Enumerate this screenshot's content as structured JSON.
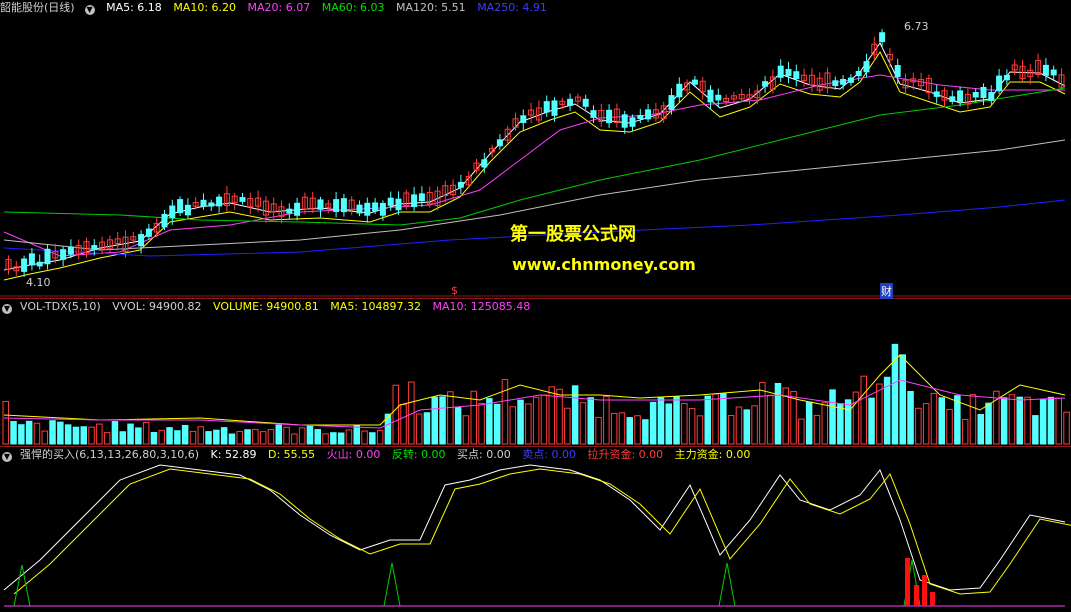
{
  "main_legend": {
    "title": "韶能股份(日线)",
    "ma5": "MA5: 6.18",
    "ma10": "MA10: 6.20",
    "ma20": "MA20: 6.07",
    "ma60": "MA60: 6.03",
    "ma120": "MA120: 5.51",
    "ma250": "MA250: 4.91"
  },
  "price_labels": {
    "high": "6.73",
    "low": "4.10"
  },
  "markers": {
    "s": "$",
    "cai": "财"
  },
  "vol_legend": {
    "name": "VOL-TDX(5,10)",
    "vvol": "VVOL: 94900.82",
    "volume": "VOLUME: 94900.81",
    "ma5": "MA5: 104897.32",
    "ma10": "MA10: 125085.48"
  },
  "ind_legend": {
    "name": "强悍的买入(6,13,13,26,80,3,10,6)",
    "k": "K: 52.89",
    "d": "D: 55.55",
    "huoshan": "火山: 0.00",
    "fanzhuan": "反转: 0.00",
    "maidian": "买点: 0.00",
    "maidian2": "卖点: 0.00",
    "lasheng": "拉升资金: 0.00",
    "zhuli": "主力资金: 0.00"
  },
  "watermark": {
    "title": "第一股票公式网",
    "url": "www.chnmoney.com"
  },
  "colors": {
    "up": "#ff3c3c",
    "down": "#54ffff",
    "ma5": "#ffffff",
    "ma10": "#ffff00",
    "ma20": "#ff40ff",
    "ma60": "#00cc00",
    "ma120": "#c0c0c0",
    "ma250": "#3030ff"
  }
}
